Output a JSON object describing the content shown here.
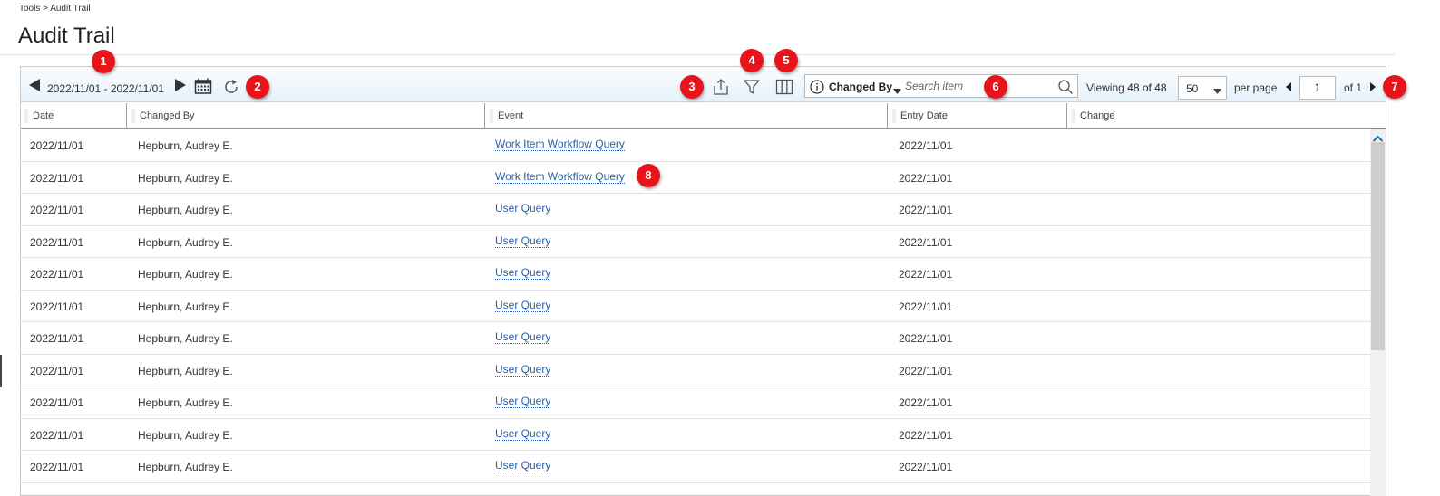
{
  "breadcrumb": "Tools > Audit Trail",
  "title": "Audit Trail",
  "toolbar": {
    "date_range": "2022/11/01 - 2022/11/01",
    "search": {
      "field": "Changed By",
      "placeholder": "Search item"
    },
    "viewing_label": "Viewing",
    "viewing_count": "48 of 48",
    "per_page_value": "50",
    "per_page_label": "per page",
    "page_value": "1",
    "page_of": "of 1"
  },
  "columns": [
    "Date",
    "Changed By",
    "Event",
    "Entry Date",
    "Change"
  ],
  "rows": [
    {
      "date": "2022/11/01",
      "changed_by": "Hepburn, Audrey E.",
      "event": "Work Item Workflow Query",
      "entry_date": "2022/11/01",
      "change": ""
    },
    {
      "date": "2022/11/01",
      "changed_by": "Hepburn, Audrey E.",
      "event": "Work Item Workflow Query",
      "entry_date": "2022/11/01",
      "change": ""
    },
    {
      "date": "2022/11/01",
      "changed_by": "Hepburn, Audrey E.",
      "event": "User Query",
      "entry_date": "2022/11/01",
      "change": ""
    },
    {
      "date": "2022/11/01",
      "changed_by": "Hepburn, Audrey E.",
      "event": "User Query",
      "entry_date": "2022/11/01",
      "change": ""
    },
    {
      "date": "2022/11/01",
      "changed_by": "Hepburn, Audrey E.",
      "event": "User Query",
      "entry_date": "2022/11/01",
      "change": ""
    },
    {
      "date": "2022/11/01",
      "changed_by": "Hepburn, Audrey E.",
      "event": "User Query",
      "entry_date": "2022/11/01",
      "change": ""
    },
    {
      "date": "2022/11/01",
      "changed_by": "Hepburn, Audrey E.",
      "event": "User Query",
      "entry_date": "2022/11/01",
      "change": ""
    },
    {
      "date": "2022/11/01",
      "changed_by": "Hepburn, Audrey E.",
      "event": "User Query",
      "entry_date": "2022/11/01",
      "change": ""
    },
    {
      "date": "2022/11/01",
      "changed_by": "Hepburn, Audrey E.",
      "event": "User Query",
      "entry_date": "2022/11/01",
      "change": ""
    },
    {
      "date": "2022/11/01",
      "changed_by": "Hepburn, Audrey E.",
      "event": "User Query",
      "entry_date": "2022/11/01",
      "change": ""
    },
    {
      "date": "2022/11/01",
      "changed_by": "Hepburn, Audrey E.",
      "event": "User Query",
      "entry_date": "2022/11/01",
      "change": ""
    }
  ],
  "callouts": [
    "1",
    "2",
    "3",
    "4",
    "5",
    "6",
    "7",
    "8"
  ],
  "colors": {
    "accent": "#2a5fa8",
    "callout": "#e8141b",
    "toolbar": "#e6f1f9"
  },
  "icons": [
    "prev-date-icon",
    "next-date-icon",
    "calendar-icon",
    "refresh-icon",
    "export-icon",
    "filter-icon",
    "columns-icon",
    "info-icon",
    "search-icon",
    "prev-page-icon",
    "next-page-icon",
    "scroll-up-icon"
  ]
}
